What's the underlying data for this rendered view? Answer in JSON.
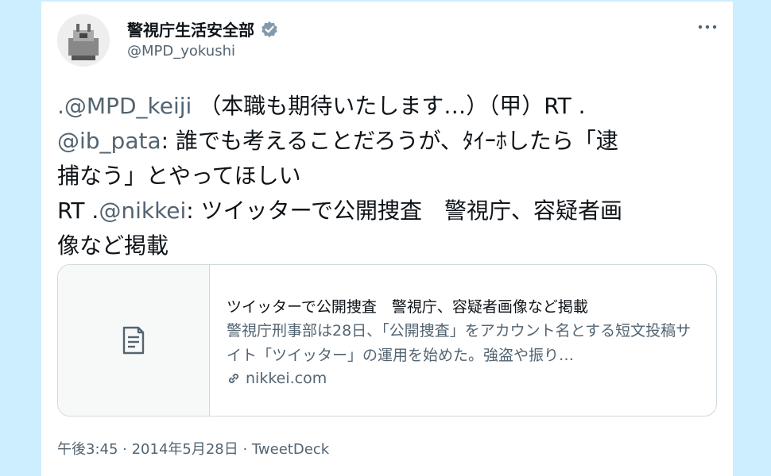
{
  "user": {
    "name": "警視庁生活安全部",
    "handle": "@MPD_yokushi"
  },
  "tweet": {
    "lines": [
      [
        {
          "text": ".@MPD_keiji",
          "mention": true
        },
        {
          "text": " （本職も期待いたします…）（甲）RT .",
          "mention": false
        }
      ],
      [
        {
          "text": "@ib_pata",
          "mention": true
        },
        {
          "text": ": 誰でも考えることだろうが、ﾀｲｰﾎしたら「逮",
          "mention": false
        }
      ],
      [
        {
          "text": "捕なう」とやってほしい",
          "mention": false
        }
      ],
      [
        {
          "text": "RT .",
          "mention": false
        },
        {
          "text": "@nikkei",
          "mention": true
        },
        {
          "text": ": ツイッターで公開捜査　警視庁、容疑者画",
          "mention": false
        }
      ],
      [
        {
          "text": "像など掲載",
          "mention": false
        }
      ]
    ]
  },
  "link_card": {
    "title": "ツイッターで公開捜査　警視庁、容疑者画像など掲載",
    "description": "警視庁刑事部は28日、「公開捜査」をアカウント名とする短文投稿サイト「ツイッター」の運用を始めた。強盗や振り…",
    "domain": "nikkei.com"
  },
  "meta": "午後3:45 · 2014年5月28日 · TweetDeck",
  "icons": {
    "more": "more-icon",
    "verified": "verified-badge-icon",
    "article": "article-icon",
    "link": "link-icon"
  },
  "colors": {
    "background": "#cdeeff",
    "card": "#ffffff",
    "text": "#0f1419",
    "secondary": "#536471",
    "border": "#cfd9de"
  }
}
